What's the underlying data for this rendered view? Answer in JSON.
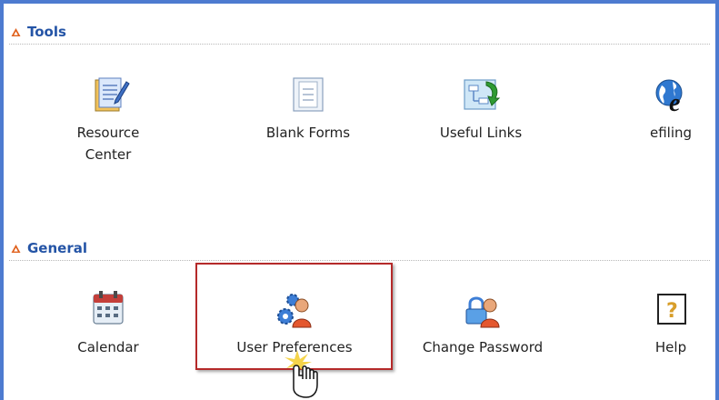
{
  "tools_section": {
    "title": "Tools"
  },
  "tools": [
    {
      "label": "Resource\nCenter",
      "icon": "resource-center-icon"
    },
    {
      "label": "Blank Forms",
      "icon": "blank-forms-icon"
    },
    {
      "label": "Useful Links",
      "icon": "useful-links-icon"
    },
    {
      "label": "efiling",
      "icon": "efiling-icon"
    }
  ],
  "general_section": {
    "title": "General"
  },
  "general": [
    {
      "label": "Calendar",
      "icon": "calendar-icon"
    },
    {
      "label": "User Preferences",
      "icon": "user-preferences-icon"
    },
    {
      "label": "Change Password",
      "icon": "change-password-icon"
    },
    {
      "label": "Help",
      "icon": "help-icon"
    }
  ],
  "colors": {
    "frame": "#4d7bd0",
    "section_title": "#2454a6",
    "highlight": "#b52a2a",
    "collapse_triangle": "#e0601b"
  }
}
